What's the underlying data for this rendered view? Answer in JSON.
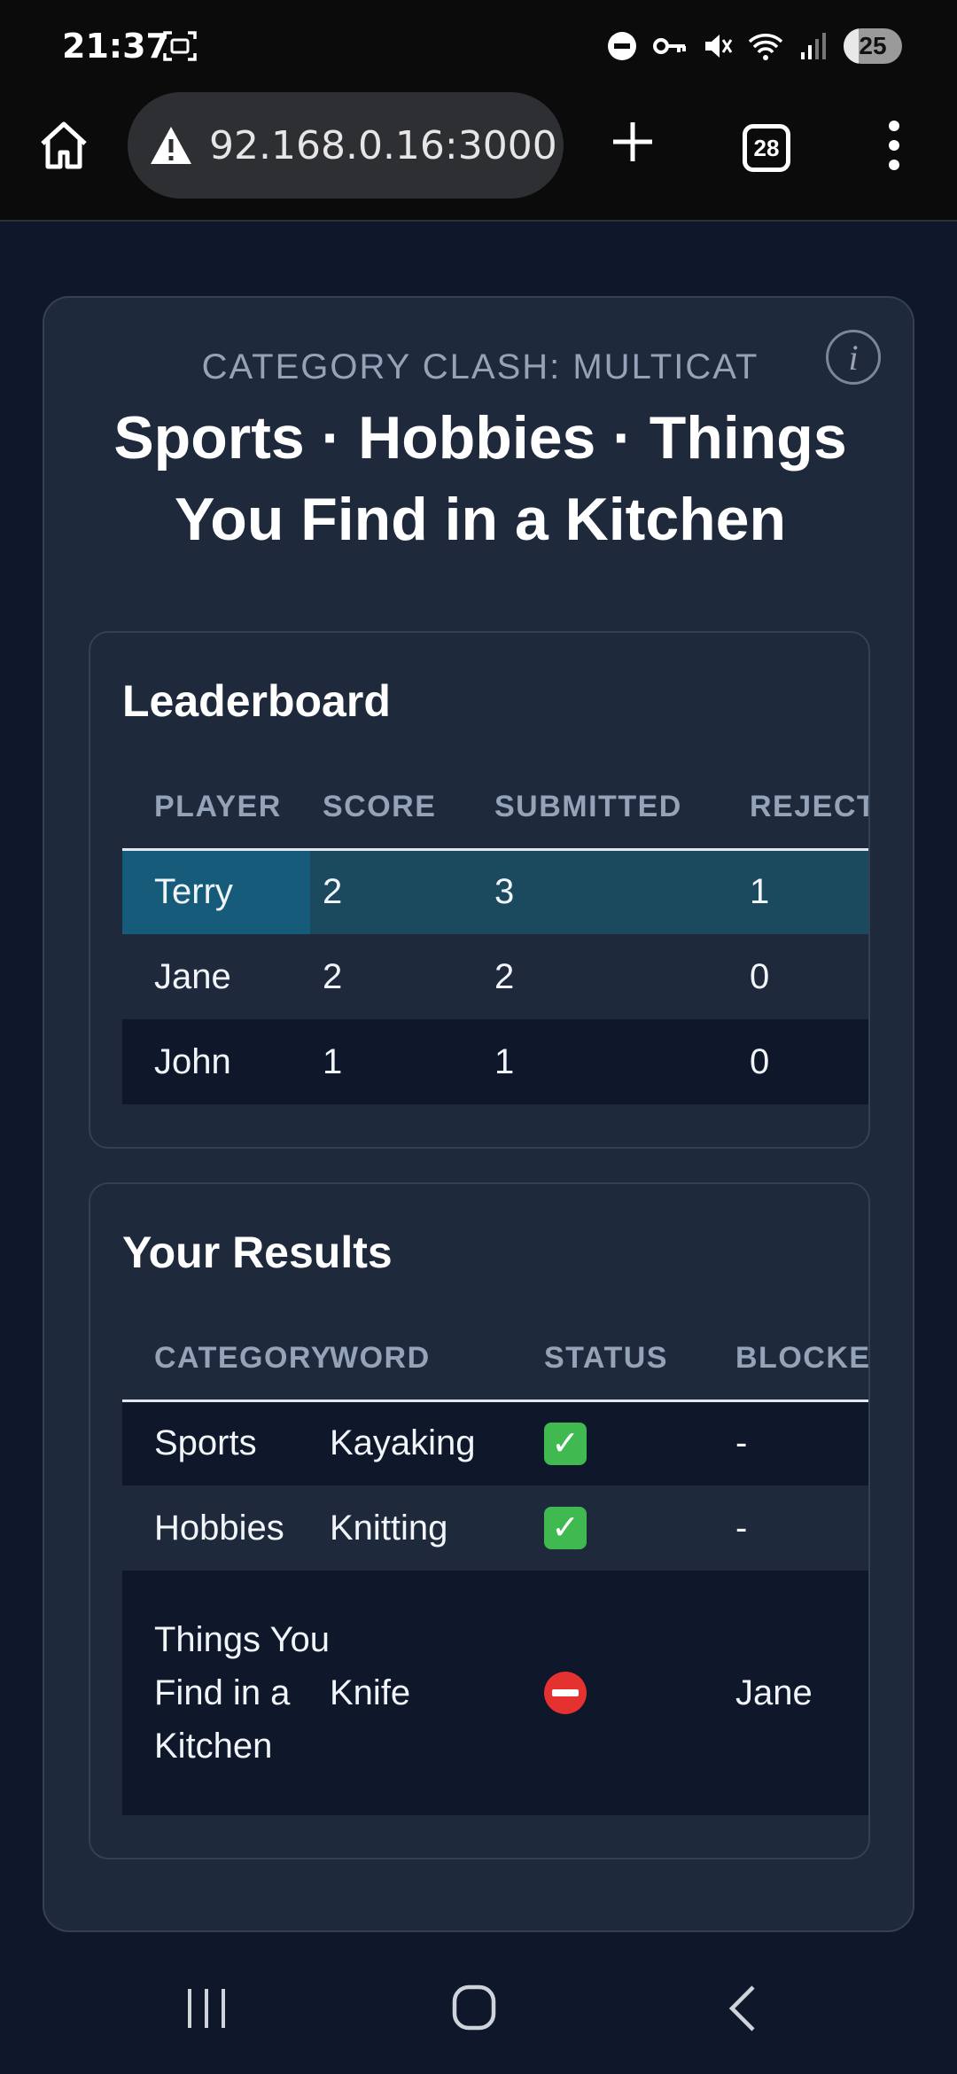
{
  "status_bar": {
    "time": "21:37",
    "battery_level": "25",
    "icons": [
      "screenshot-icon",
      "dnd-icon",
      "vpn-key-icon",
      "mute-icon",
      "wifi-icon",
      "signal-icon",
      "battery-icon"
    ]
  },
  "browser": {
    "url": "92.168.0.16:3000",
    "tab_count": "28",
    "icons": [
      "home-icon",
      "warning-icon",
      "plus-icon",
      "tabs-icon",
      "more-icon"
    ]
  },
  "game": {
    "mode": "CATEGORY CLASH: MULTICAT",
    "title": "Sports · Hobbies · Things You Find in a Kitchen"
  },
  "leaderboard": {
    "title": "Leaderboard",
    "columns": [
      "PLAYER",
      "SCORE",
      "SUBMITTED",
      "REJECTED"
    ],
    "rows": [
      {
        "player": "Terry",
        "score": "2",
        "submitted": "3",
        "rejected": "1"
      },
      {
        "player": "Jane",
        "score": "2",
        "submitted": "2",
        "rejected": "0"
      },
      {
        "player": "John",
        "score": "1",
        "submitted": "1",
        "rejected": "0"
      }
    ]
  },
  "results": {
    "title": "Your Results",
    "columns": [
      "CATEGORY",
      "WORD",
      "STATUS",
      "BLOCKED BY"
    ],
    "rows": [
      {
        "category": "Sports",
        "word": "Kayaking",
        "status": "accepted",
        "blocked_by": "-"
      },
      {
        "category": "Hobbies",
        "word": "Knitting",
        "status": "accepted",
        "blocked_by": "-"
      },
      {
        "category": "Things You Find in a Kitchen",
        "word": "Knife",
        "status": "rejected",
        "blocked_by": "Jane"
      }
    ]
  },
  "colors": {
    "page_bg": "#0f172a",
    "card_bg": "#1e293b",
    "highlight_row": "#1b4a5f",
    "accepted": "#3fb950",
    "rejected": "#e5312f"
  }
}
